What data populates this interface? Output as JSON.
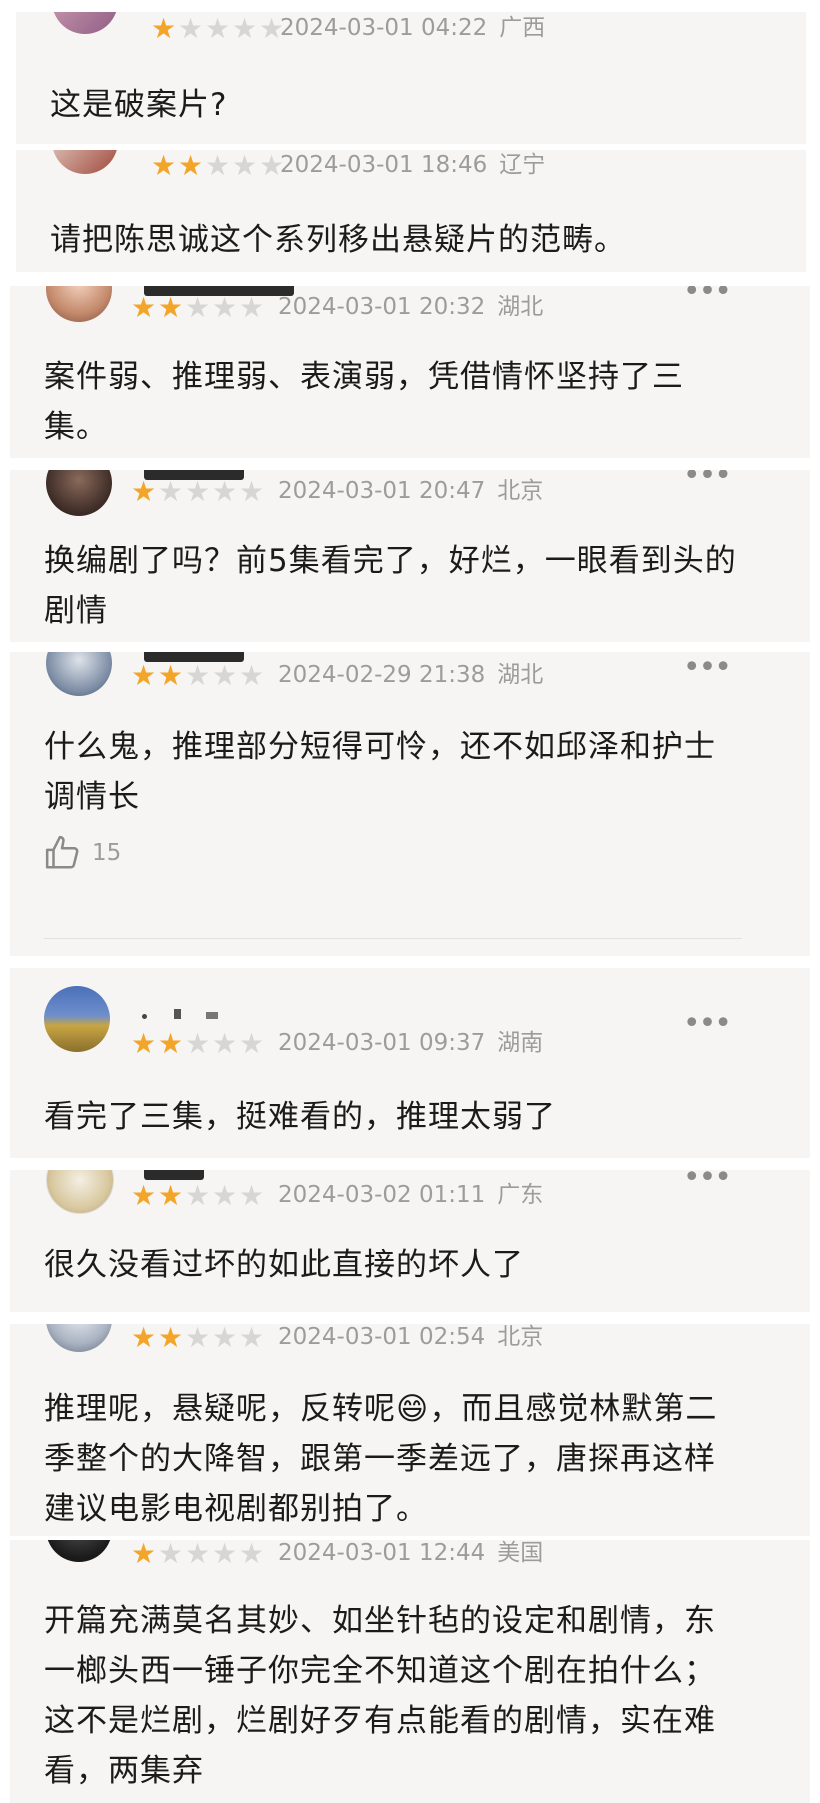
{
  "comments": [
    {
      "rating": 1,
      "date": "2024-03-01 04:22",
      "location": "广西",
      "text": "这是破案片?"
    },
    {
      "rating": 2,
      "date": "2024-03-01 18:46",
      "location": "辽宁",
      "text": "请把陈思诚这个系列移出悬疑片的范畴。"
    },
    {
      "rating": 2,
      "date": "2024-03-01 20:32",
      "location": "湖北",
      "text": "案件弱、推理弱、表演弱，凭借情怀坚持了三集。"
    },
    {
      "rating": 1,
      "date": "2024-03-01 20:47",
      "location": "北京",
      "text": "换编剧了吗？前5集看完了，好烂，一眼看到头的剧情"
    },
    {
      "rating": 2,
      "date": "2024-02-29 21:38",
      "location": "湖北",
      "text": "什么鬼，推理部分短得可怜，还不如邱泽和护士调情长",
      "likes": "15"
    },
    {
      "rating": 2,
      "date": "2024-03-01 09:37",
      "location": "湖南",
      "text": "看完了三集，挺难看的，推理太弱了"
    },
    {
      "rating": 2,
      "date": "2024-03-02 01:11",
      "location": "广东",
      "text": "很久没看过坏的如此直接的坏人了"
    },
    {
      "rating": 2,
      "date": "2024-03-01 02:54",
      "location": "北京",
      "text": "推理呢，悬疑呢，反转呢😄，而且感觉林默第二季整个的大降智，跟第一季差远了，唐探再这样建议电影电视剧都别拍了。"
    },
    {
      "rating": 1,
      "date": "2024-03-01 12:44",
      "location": "美国",
      "text": "开篇充满莫名其妙、如坐针毡的设定和剧情，东一榔头西一锤子你完全不知道这个剧在拍什么；这不是烂剧，烂剧好歹有点能看的剧情，实在难看，两集弃"
    }
  ],
  "icons": {
    "star": "star-icon",
    "more": "more-dots-icon",
    "like": "thumbs-up-icon"
  },
  "colors": {
    "star_on": "#f3a52a",
    "star_off": "#d6d6d6",
    "meta": "#9c9c9c",
    "card_bg": "#f6f5f3"
  }
}
